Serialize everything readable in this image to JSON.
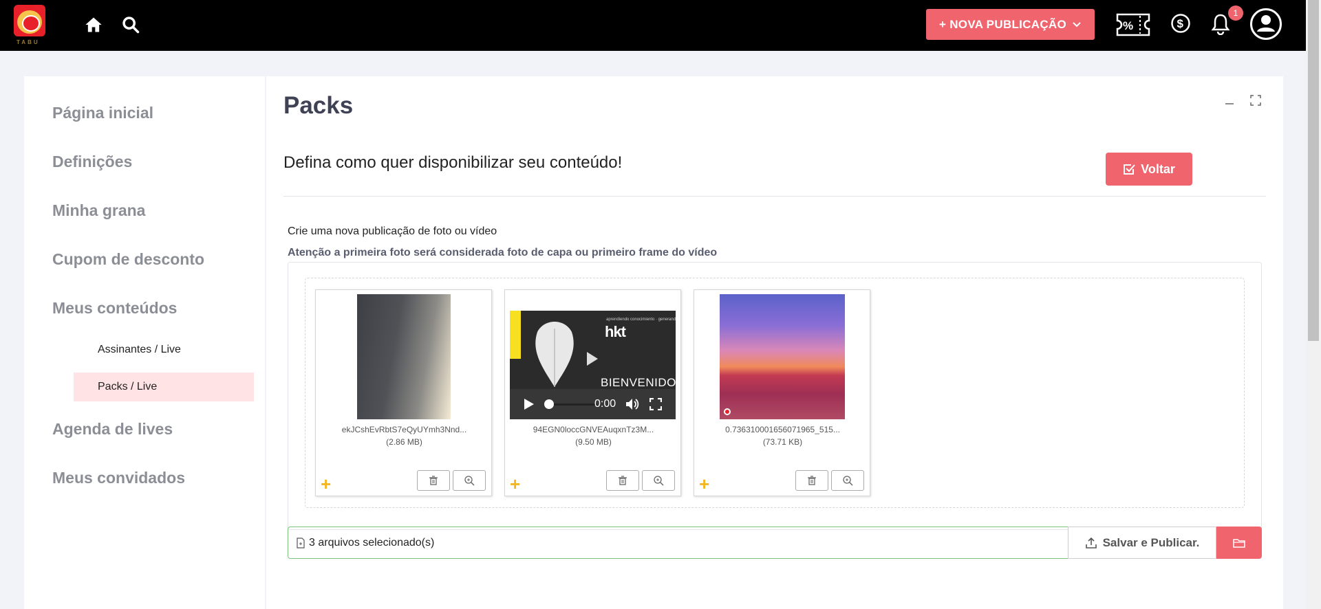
{
  "logo": {
    "text": "TABU"
  },
  "topbar": {
    "new_post_label": "+ NOVA PUBLICAÇÃO",
    "notification_count": "1"
  },
  "sidebar": {
    "items": [
      {
        "label": "Página inicial"
      },
      {
        "label": "Definições"
      },
      {
        "label": "Minha grana"
      },
      {
        "label": "Cupom de desconto"
      },
      {
        "label": "Meus conteúdos"
      },
      {
        "label": "Agenda de lives"
      },
      {
        "label": "Meus convidados"
      }
    ],
    "sub_items": [
      {
        "label": "Assinantes / Live",
        "active": false
      },
      {
        "label": "Packs / Live",
        "active": true
      }
    ]
  },
  "main": {
    "title": "Packs",
    "subtitle": "Defina como quer disponibilizar seu conteúdo!",
    "back_button": "Voltar",
    "info_line": "Crie uma nova publicação de foto ou vídeo",
    "info_warning": "Atenção a primeira foto será considerada foto de capa ou primeiro frame do vídeo",
    "files": [
      {
        "name": "ekJCshEvRbtS7eQyUYmh3Nnd...",
        "size": "(2.86 MB)",
        "type": "image"
      },
      {
        "name": "94EGN0loccGNVEAuqxnTz3M...",
        "size": "(9.50 MB)",
        "type": "video",
        "video_brand": "hkt",
        "video_text": "BIENVENIDOS",
        "video_time": "0:00"
      },
      {
        "name": "0.736310001656071965_515...",
        "size": "(73.71 KB)",
        "type": "image"
      }
    ],
    "selected_text": "3 arquivos selecionado(s)",
    "save_button": "Salvar e Publicar."
  },
  "colors": {
    "accent": "#f0646e",
    "topbar": "#000000",
    "active_bg": "#ffe3e5",
    "plus": "#f3b61f",
    "selected_border": "#7bc57d"
  }
}
